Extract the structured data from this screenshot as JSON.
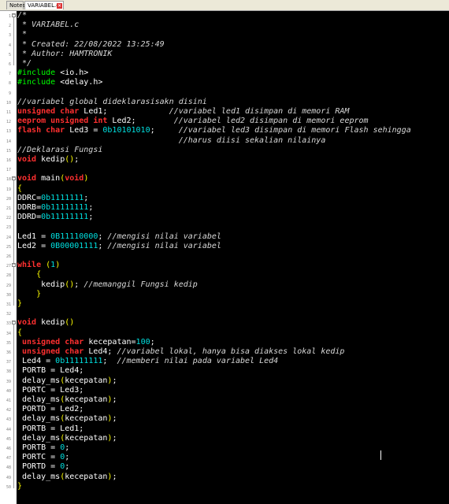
{
  "tabs": [
    {
      "label": "Notes"
    },
    {
      "label": "VARIABEL.c"
    }
  ],
  "code_lines": [
    {
      "n": "1",
      "segs": [
        [
          "c",
          "/*"
        ]
      ]
    },
    {
      "n": "2",
      "segs": [
        [
          "c",
          " * VARIABEL.c"
        ]
      ]
    },
    {
      "n": "3",
      "segs": [
        [
          "c",
          " *"
        ]
      ]
    },
    {
      "n": "4",
      "segs": [
        [
          "c",
          " * Created: 22/08/2022 13:25:49"
        ]
      ]
    },
    {
      "n": "5",
      "segs": [
        [
          "c",
          " * Author: HAMTRONIK"
        ]
      ]
    },
    {
      "n": "6",
      "segs": [
        [
          "c",
          " */"
        ]
      ]
    },
    {
      "n": "7",
      "segs": [
        [
          "p",
          "#include "
        ],
        [
          "t",
          "<io.h>"
        ]
      ]
    },
    {
      "n": "8",
      "segs": [
        [
          "p",
          "#include "
        ],
        [
          "t",
          "<delay.h>"
        ]
      ]
    },
    {
      "n": "9",
      "segs": []
    },
    {
      "n": "10",
      "segs": [
        [
          "c",
          "//variabel global dideklarasisakn disini"
        ]
      ]
    },
    {
      "n": "11",
      "segs": [
        [
          "k",
          "unsigned char "
        ],
        [
          "t",
          "Led1;             "
        ],
        [
          "c",
          "//variabel led1 disimpan di memori RAM"
        ]
      ]
    },
    {
      "n": "12",
      "segs": [
        [
          "k",
          "eeprom unsigned int "
        ],
        [
          "t",
          "Led2;        "
        ],
        [
          "c",
          "//variabel led2 disimpan di memori eeprom"
        ]
      ]
    },
    {
      "n": "13",
      "segs": [
        [
          "k",
          "flash char "
        ],
        [
          "t",
          "Led3 = "
        ],
        [
          "n",
          "0b10101010"
        ],
        [
          "t",
          ";     "
        ],
        [
          "c",
          "//variabel led3 disimpan di memori Flash sehingga"
        ]
      ]
    },
    {
      "n": "14",
      "segs": [
        [
          "t",
          "                                  "
        ],
        [
          "c",
          "//harus diisi sekalian nilainya"
        ]
      ]
    },
    {
      "n": "15",
      "segs": [
        [
          "c",
          "//Deklarasi Fungsi"
        ]
      ]
    },
    {
      "n": "16",
      "segs": [
        [
          "k",
          "void "
        ],
        [
          "t",
          "kedip"
        ],
        [
          "br",
          "()"
        ],
        [
          "t",
          ";"
        ]
      ]
    },
    {
      "n": "17",
      "segs": []
    },
    {
      "n": "18",
      "segs": [
        [
          "k",
          "void "
        ],
        [
          "t",
          "main"
        ],
        [
          "br",
          "("
        ],
        [
          "k",
          "void"
        ],
        [
          "br",
          ")"
        ]
      ]
    },
    {
      "n": "19",
      "segs": [
        [
          "br",
          "{"
        ]
      ]
    },
    {
      "n": "20",
      "segs": [
        [
          "t",
          "DDRC="
        ],
        [
          "n",
          "0b1111111"
        ],
        [
          "t",
          ";"
        ]
      ]
    },
    {
      "n": "21",
      "segs": [
        [
          "t",
          "DDRB="
        ],
        [
          "n",
          "0b11111111"
        ],
        [
          "t",
          ";"
        ]
      ]
    },
    {
      "n": "22",
      "segs": [
        [
          "t",
          "DDRD="
        ],
        [
          "n",
          "0b11111111"
        ],
        [
          "t",
          ";"
        ]
      ]
    },
    {
      "n": "23",
      "segs": []
    },
    {
      "n": "24",
      "segs": [
        [
          "t",
          "Led1 = "
        ],
        [
          "n",
          "0B11110000"
        ],
        [
          "t",
          "; "
        ],
        [
          "c",
          "//mengisi nilai variabel"
        ]
      ]
    },
    {
      "n": "25",
      "segs": [
        [
          "t",
          "Led2 = "
        ],
        [
          "n",
          "0B00001111"
        ],
        [
          "t",
          "; "
        ],
        [
          "c",
          "//mengisi nilai variabel"
        ]
      ]
    },
    {
      "n": "26",
      "segs": []
    },
    {
      "n": "27",
      "segs": [
        [
          "k",
          "while "
        ],
        [
          "br",
          "("
        ],
        [
          "n",
          "1"
        ],
        [
          "br",
          ")"
        ]
      ]
    },
    {
      "n": "28",
      "segs": [
        [
          "t",
          "    "
        ],
        [
          "br",
          "{"
        ]
      ]
    },
    {
      "n": "29",
      "segs": [
        [
          "t",
          "     kedip"
        ],
        [
          "br",
          "()"
        ],
        [
          "t",
          "; "
        ],
        [
          "c",
          "//memanggil Fungsi kedip"
        ]
      ]
    },
    {
      "n": "30",
      "segs": [
        [
          "t",
          "    "
        ],
        [
          "br",
          "}"
        ]
      ]
    },
    {
      "n": "31",
      "segs": [
        [
          "br",
          "}"
        ]
      ]
    },
    {
      "n": "32",
      "segs": []
    },
    {
      "n": "33",
      "segs": [
        [
          "k",
          "void "
        ],
        [
          "t",
          "kedip"
        ],
        [
          "br",
          "()"
        ]
      ]
    },
    {
      "n": "34",
      "segs": [
        [
          "br",
          "{"
        ]
      ]
    },
    {
      "n": "35",
      "segs": [
        [
          "t",
          " "
        ],
        [
          "k",
          "unsigned char "
        ],
        [
          "t",
          "kecepatan="
        ],
        [
          "n",
          "100"
        ],
        [
          "t",
          ";"
        ]
      ]
    },
    {
      "n": "36",
      "segs": [
        [
          "t",
          " "
        ],
        [
          "k",
          "unsigned char "
        ],
        [
          "t",
          "Led4; "
        ],
        [
          "c",
          "//variabel lokal, hanya bisa diakses lokal kedip"
        ]
      ]
    },
    {
      "n": "37",
      "segs": [
        [
          "t",
          " Led4 = "
        ],
        [
          "n",
          "0b11111111"
        ],
        [
          "t",
          ";  "
        ],
        [
          "c",
          "//memberi nilai pada variabel Led4"
        ]
      ]
    },
    {
      "n": "38",
      "segs": [
        [
          "t",
          " PORTB = Led4;"
        ]
      ]
    },
    {
      "n": "39",
      "segs": [
        [
          "t",
          " delay_ms"
        ],
        [
          "br",
          "("
        ],
        [
          "t",
          "kecepatan"
        ],
        [
          "br",
          ")"
        ],
        [
          "t",
          ";"
        ]
      ]
    },
    {
      "n": "40",
      "segs": [
        [
          "t",
          " PORTC = Led3;"
        ]
      ]
    },
    {
      "n": "41",
      "segs": [
        [
          "t",
          " delay_ms"
        ],
        [
          "br",
          "("
        ],
        [
          "t",
          "kecepatan"
        ],
        [
          "br",
          ")"
        ],
        [
          "t",
          ";"
        ]
      ]
    },
    {
      "n": "42",
      "segs": [
        [
          "t",
          " PORTD = Led2;"
        ]
      ]
    },
    {
      "n": "43",
      "segs": [
        [
          "t",
          " delay_ms"
        ],
        [
          "br",
          "("
        ],
        [
          "t",
          "kecepatan"
        ],
        [
          "br",
          ")"
        ],
        [
          "t",
          ";"
        ]
      ]
    },
    {
      "n": "44",
      "segs": [
        [
          "t",
          " PORTB = Led1;"
        ]
      ]
    },
    {
      "n": "45",
      "segs": [
        [
          "t",
          " delay_ms"
        ],
        [
          "br",
          "("
        ],
        [
          "t",
          "kecepatan"
        ],
        [
          "br",
          ")"
        ],
        [
          "t",
          ";"
        ]
      ]
    },
    {
      "n": "46",
      "segs": [
        [
          "t",
          " PORTB = "
        ],
        [
          "n",
          "0"
        ],
        [
          "t",
          ";"
        ]
      ]
    },
    {
      "n": "47",
      "segs": [
        [
          "t",
          " PORTC = "
        ],
        [
          "n",
          "0"
        ],
        [
          "t",
          ";"
        ]
      ]
    },
    {
      "n": "48",
      "segs": [
        [
          "t",
          " PORTD = "
        ],
        [
          "n",
          "0"
        ],
        [
          "t",
          ";"
        ]
      ]
    },
    {
      "n": "49",
      "segs": [
        [
          "t",
          " delay_ms"
        ],
        [
          "br",
          "("
        ],
        [
          "t",
          "kecepatan"
        ],
        [
          "br",
          ")"
        ],
        [
          "t",
          ";"
        ]
      ]
    },
    {
      "n": "50",
      "segs": [
        [
          "br",
          "}"
        ]
      ]
    }
  ],
  "close_icon": "close-icon"
}
